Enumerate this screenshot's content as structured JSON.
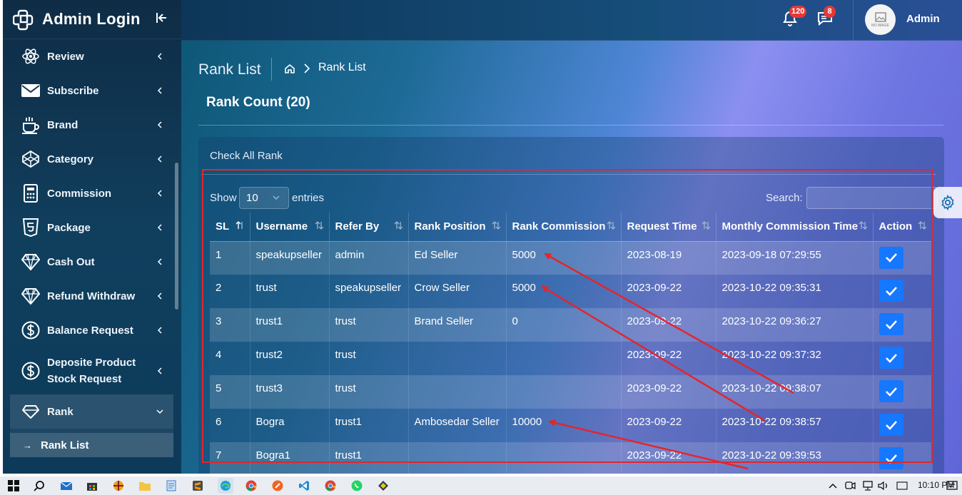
{
  "app": {
    "title": "Admin Login"
  },
  "sidebar": {
    "items": [
      {
        "label": "Review",
        "icon": "atom-icon"
      },
      {
        "label": "Subscribe",
        "icon": "envelope-icon"
      },
      {
        "label": "Brand",
        "icon": "coffee-cup-icon"
      },
      {
        "label": "Category",
        "icon": "codepen-cube-icon"
      },
      {
        "label": "Commission",
        "icon": "calculator-icon"
      },
      {
        "label": "Package",
        "icon": "html5-shield-icon"
      },
      {
        "label": "Cash Out",
        "icon": "diamond-icon"
      },
      {
        "label": "Refund Withdraw",
        "icon": "diamond-icon"
      },
      {
        "label": "Balance Request",
        "icon": "dollar-circle-icon"
      },
      {
        "label": "Deposite Product Stock Request",
        "icon": "dollar-circle-icon"
      },
      {
        "label": "Rank",
        "icon": "gem-icon"
      }
    ],
    "submenu": {
      "label": "Rank List"
    }
  },
  "header": {
    "notifications_count": "120",
    "messages_count": "8",
    "avatar_text": "NO IMAGE",
    "user_name": "Admin"
  },
  "breadcrumb": {
    "title": "Rank List",
    "current": "Rank List"
  },
  "page": {
    "count_title": "Rank Count (20)",
    "card_title": "Check All Rank"
  },
  "datatable": {
    "show_label": "Show",
    "entries_value": "10",
    "entries_label": "entries",
    "search_label": "Search:",
    "columns": [
      "SL",
      "Username",
      "Refer By",
      "Rank Position",
      "Rank Commission",
      "Request Time",
      "Monthly Commission Time",
      "Action"
    ],
    "rows": [
      {
        "sl": "1",
        "username": "speakupseller",
        "refer_by": "admin",
        "rank_position": "Ed Seller",
        "rank_commission": "5000",
        "request_time": "2023-08-19",
        "monthly_time": "2023-09-18 07:29:55"
      },
      {
        "sl": "2",
        "username": "trust",
        "refer_by": "speakupseller",
        "rank_position": "Crow Seller",
        "rank_commission": "5000",
        "request_time": "2023-09-22",
        "monthly_time": "2023-10-22 09:35:31"
      },
      {
        "sl": "3",
        "username": "trust1",
        "refer_by": "trust",
        "rank_position": "Brand Seller",
        "rank_commission": "0",
        "request_time": "2023-09-22",
        "monthly_time": "2023-10-22 09:36:27"
      },
      {
        "sl": "4",
        "username": "trust2",
        "refer_by": "trust",
        "rank_position": "",
        "rank_commission": "",
        "request_time": "2023-09-22",
        "monthly_time": "2023-10-22 09:37:32"
      },
      {
        "sl": "5",
        "username": "trust3",
        "refer_by": "trust",
        "rank_position": "",
        "rank_commission": "",
        "request_time": "2023-09-22",
        "monthly_time": "2023-10-22 09:38:07"
      },
      {
        "sl": "6",
        "username": "Bogra",
        "refer_by": "trust1",
        "rank_position": "Ambosedar Seller",
        "rank_commission": "10000",
        "request_time": "2023-09-22",
        "monthly_time": "2023-10-22 09:38:57"
      },
      {
        "sl": "7",
        "username": "Bogra1",
        "refer_by": "trust1",
        "rank_position": "",
        "rank_commission": "",
        "request_time": "2023-09-22",
        "monthly_time": "2023-10-22 09:39:53"
      }
    ]
  },
  "taskbar": {
    "time": "10:10 PM"
  },
  "colors": {
    "annotation": "#e3262b",
    "accent": "#1677ff",
    "badge": "#e53935"
  }
}
